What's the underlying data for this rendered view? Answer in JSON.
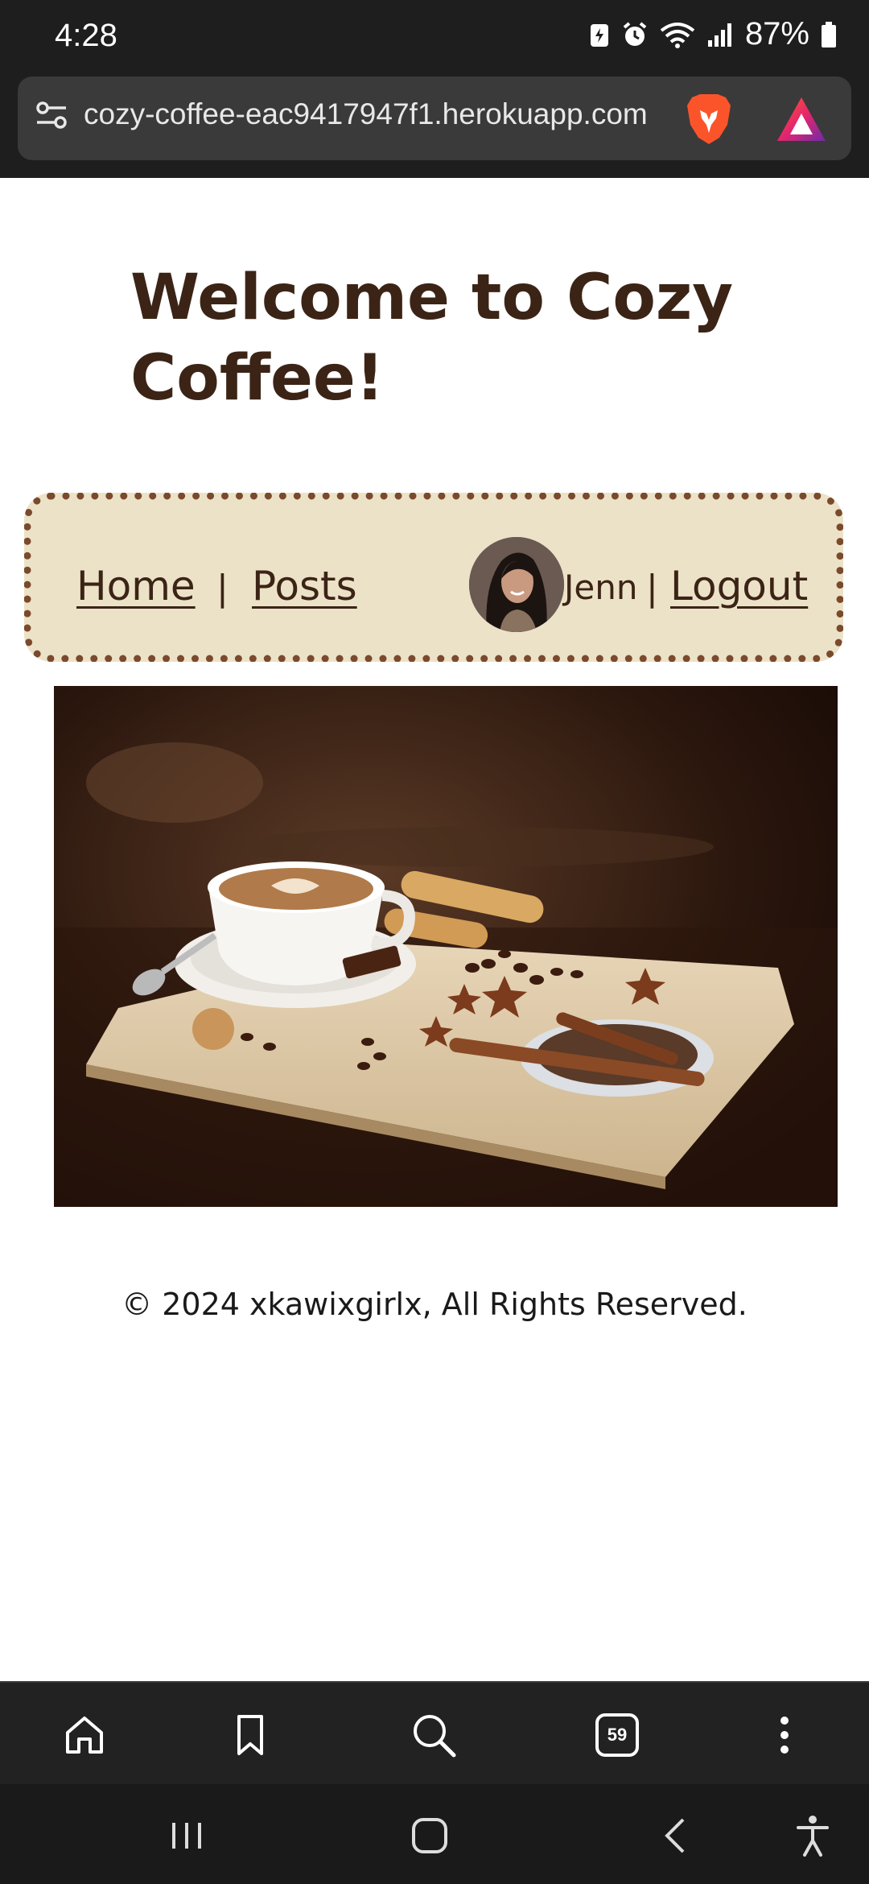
{
  "status_bar": {
    "time": "4:28",
    "battery": "87%"
  },
  "browser": {
    "url": "cozy-coffee-eac9417947f1.herokuapp.com",
    "tabs_count": "59"
  },
  "page": {
    "title": "Welcome to Cozy Coffee!",
    "nav": {
      "home": "Home",
      "separator": "|",
      "posts": "Posts",
      "username": "Jenn",
      "user_separator": "|",
      "logout": "Logout"
    },
    "footer": "© 2024 xkawixgirlx, All Rights Reserved."
  },
  "colors": {
    "heading": "#3b2416",
    "nav_background": "#ece2c8",
    "nav_border": "#7a4a2c"
  },
  "icons": [
    "tune-icon",
    "brave-lion-icon",
    "brave-rewards-icon",
    "home-icon",
    "bookmark-icon",
    "search-icon",
    "tabs-icon",
    "more-icon",
    "recents-icon",
    "system-home-icon",
    "back-icon",
    "accessibility-icon"
  ]
}
